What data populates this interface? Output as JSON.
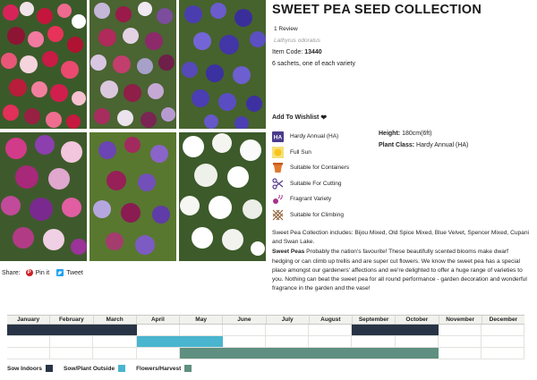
{
  "product": {
    "title": "SWEET PEA SEED COLLECTION",
    "review": "1 Review",
    "latin_name": "Lathyrus odoratus",
    "item_code_label": "Item Code:",
    "item_code": "13440",
    "sachets": "6 sachets, one of each variety",
    "wishlist": "Add To Wishlist"
  },
  "attributes": [
    {
      "label": "Hardy Annual (HA)",
      "icon": "hardy-annual-badge",
      "badge": "HA"
    },
    {
      "label": "Full Sun",
      "icon": "sun-icon"
    },
    {
      "label": "Suitable for Containers",
      "icon": "pot-icon"
    },
    {
      "label": "Suitable For Cutting",
      "icon": "scissors-icon"
    },
    {
      "label": "Fragrant Variety",
      "icon": "fragrance-icon"
    },
    {
      "label": "Suitable for Climbing",
      "icon": "trellis-icon"
    }
  ],
  "specs": {
    "height_label": "Height:",
    "height_value": "180cm(6ft)",
    "plant_class_label": "Plant Class:",
    "plant_class_value": "Hardy Annual (HA)"
  },
  "description": {
    "intro": "Sweet Pea Collection includes: Bijou Mixed, Old Spice Mixed, Blue Velvet, Spencer Mixed, Cupani and Swan Lake.",
    "lead": "Sweet Peas",
    "body": " Probably the nation's favourite! These beautifully scented blooms make dwarf hedging or can climb up trellis and are super cut flowers. We know the sweet pea has a special place amongst our gardeners' affections and we're delighted to offer a huge range of varieties to you. Nothing can beat the sweet pea for all round performance - garden decoration and wonderful fragrance in the garden and the vase!"
  },
  "share": {
    "label": "Share:",
    "pin": "Pin it",
    "tweet": "Tweet"
  },
  "calendar": {
    "months": [
      "January",
      "February",
      "March",
      "April",
      "May",
      "June",
      "July",
      "August",
      "September",
      "October",
      "November",
      "December"
    ],
    "rows": [
      {
        "name": "Sow Indoors",
        "color": "#283445",
        "spans": [
          [
            1,
            3
          ],
          [
            9,
            10
          ]
        ]
      },
      {
        "name": "Sow/Plant Outside",
        "color": "#49b5cf",
        "spans": [
          [
            4,
            5
          ]
        ]
      },
      {
        "name": "Flowers/Harvest",
        "color": "#5f8f80",
        "spans": [
          [
            5,
            10
          ]
        ]
      }
    ]
  },
  "legend": [
    {
      "label": "Sow Indoors",
      "color": "#283445"
    },
    {
      "label": "Sow/Plant Outside",
      "color": "#49b5cf"
    },
    {
      "label": "Flowers/Harvest",
      "color": "#5f8f80"
    }
  ]
}
